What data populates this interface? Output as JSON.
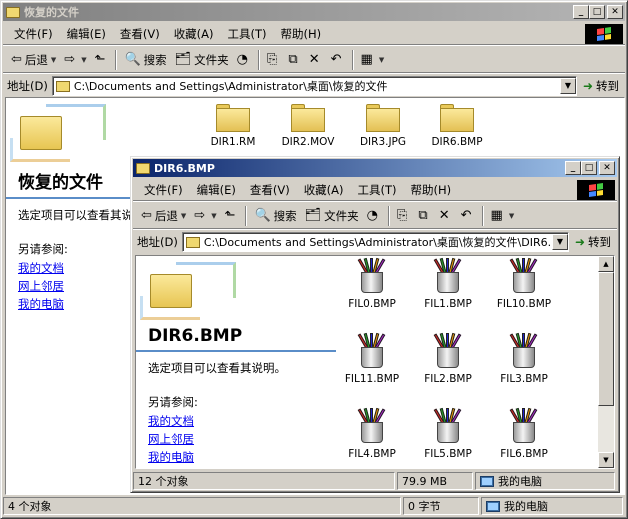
{
  "menu": [
    "文件(F)",
    "编辑(E)",
    "查看(V)",
    "收藏(A)",
    "工具(T)",
    "帮助(H)"
  ],
  "toolbar": {
    "back": "后退",
    "search": "搜索",
    "folders": "文件夹"
  },
  "address_label": "地址(D)",
  "go_label": "转到",
  "outer": {
    "title": "恢复的文件",
    "address": "C:\\Documents and Settings\\Administrator\\桌面\\恢复的文件",
    "folders": [
      {
        "name": "DIR1.RM"
      },
      {
        "name": "DIR2.MOV"
      },
      {
        "name": "DIR3.JPG"
      },
      {
        "name": "DIR6.BMP"
      }
    ],
    "webview": {
      "title": "恢复的文件",
      "desc": "选定项目可以查看其说明。",
      "see_also": "另请参阅:",
      "links": [
        "我的文档",
        "网上邻居",
        "我的电脑"
      ]
    },
    "status": {
      "count": "4 个对象",
      "size": "0 字节",
      "location": "我的电脑"
    }
  },
  "inner": {
    "title": "DIR6.BMP",
    "address": "C:\\Documents and Settings\\Administrator\\桌面\\恢复的文件\\DIR6.BMP",
    "files": [
      {
        "name": "FIL0.BMP"
      },
      {
        "name": "FIL1.BMP"
      },
      {
        "name": "FIL10.BMP"
      },
      {
        "name": "FIL11.BMP"
      },
      {
        "name": "FIL2.BMP"
      },
      {
        "name": "FIL3.BMP"
      },
      {
        "name": "FIL4.BMP"
      },
      {
        "name": "FIL5.BMP"
      },
      {
        "name": "FIL6.BMP"
      }
    ],
    "webview": {
      "title": "DIR6.BMP",
      "desc": "选定项目可以查看其说明。",
      "see_also": "另请参阅:",
      "links": [
        "我的文档",
        "网上邻居",
        "我的电脑"
      ]
    },
    "status": {
      "count": "12 个对象",
      "size": "79.9 MB",
      "location": "我的电脑"
    }
  }
}
